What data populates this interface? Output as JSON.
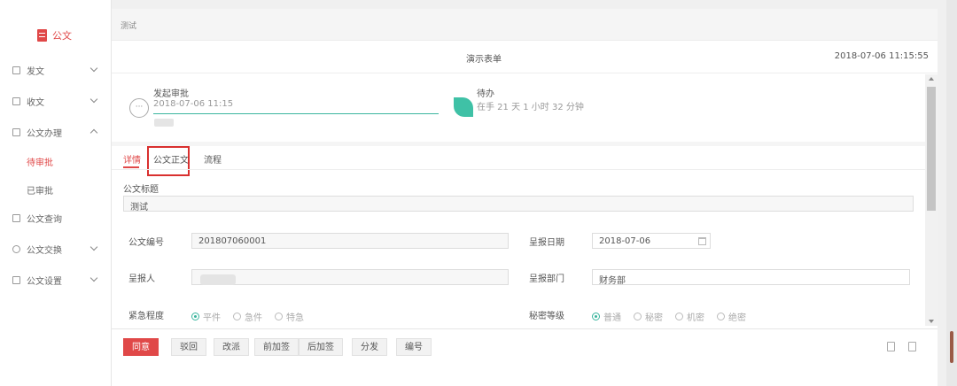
{
  "sidebar": {
    "logo_label": "公文",
    "items": [
      {
        "label": "发文",
        "icon": "doc-send-icon"
      },
      {
        "label": "收文",
        "icon": "doc-receive-icon"
      },
      {
        "label": "公文办理",
        "icon": "doc-process-icon"
      },
      {
        "label": "公文查询",
        "icon": "doc-search-icon"
      },
      {
        "label": "公文交换",
        "icon": "doc-exchange-icon"
      },
      {
        "label": "公文设置",
        "icon": "doc-settings-icon"
      }
    ],
    "sub_items": [
      {
        "label": "待审批",
        "active": true
      },
      {
        "label": "已审批",
        "active": false
      }
    ]
  },
  "breadcrumb": "测试",
  "form": {
    "title": "演示表单",
    "timestamp": "2018-07-06 11:15:55"
  },
  "flow": {
    "start_label": "发起审批",
    "start_time": "2018-07-06 11:15",
    "start_icon": "···",
    "pending_label": "待办",
    "pending_text": "在手 21 天 1 小时 32 分钟"
  },
  "tabs": [
    "详情",
    "公文正文",
    "流程"
  ],
  "fields": {
    "title_label": "公文标题",
    "title_value": "测试",
    "number_label": "公文编号",
    "number_value": "201807060001",
    "date_label": "呈报日期",
    "date_value": "2018-07-06",
    "person_label": "呈报人",
    "dept_label": "呈报部门",
    "dept_value": "财务部",
    "urgency_label": "紧急程度",
    "urgency_options": [
      "平件",
      "急件",
      "特急"
    ],
    "secret_label": "秘密等级",
    "secret_options": [
      "普通",
      "秘密",
      "机密",
      "绝密"
    ]
  },
  "toolbar": {
    "buttons": [
      "同意",
      "驳回",
      "改派",
      "前加签",
      "后加签",
      "分发",
      "编号"
    ]
  },
  "colors": {
    "accent": "#e04848",
    "flow_green": "#3ab59e"
  }
}
